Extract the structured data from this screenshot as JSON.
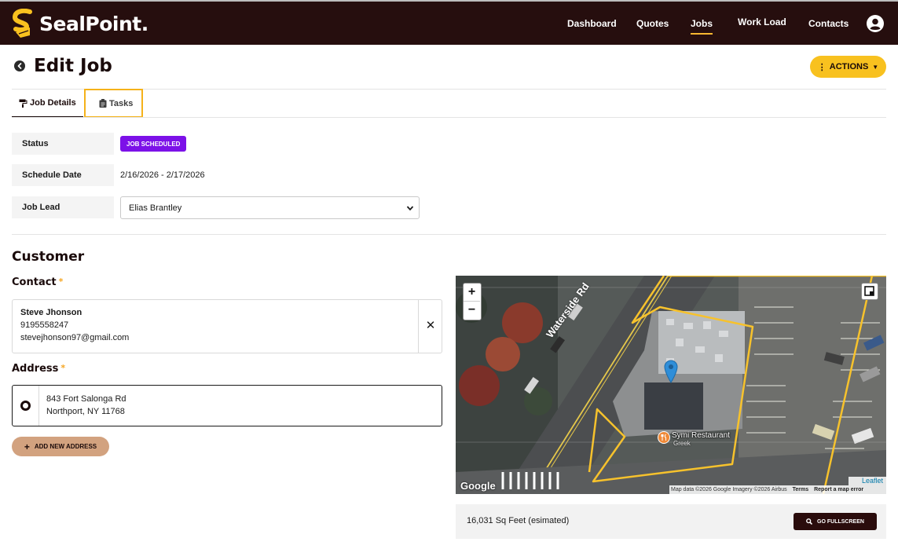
{
  "app": {
    "brand": "SealPoint."
  },
  "nav": {
    "items": [
      {
        "label": "Dashboard"
      },
      {
        "label": "Quotes"
      },
      {
        "label": "Jobs",
        "active": true
      },
      {
        "label": "Work Load"
      },
      {
        "label": "Contacts"
      }
    ],
    "user_icon": "user-circle-icon"
  },
  "header": {
    "title": "Edit Job",
    "back_icon": "arrow-left-circle-icon",
    "actions_label": "ACTIONS"
  },
  "tabs": [
    {
      "label": "Job Details",
      "icon": "paint-roller-icon",
      "active": true
    },
    {
      "label": "Tasks",
      "icon": "clipboard-icon",
      "highlighted": true
    }
  ],
  "details": {
    "status": {
      "label": "Status",
      "value": "JOB SCHEDULED"
    },
    "schedule": {
      "label": "Schedule Date",
      "value": "2/16/2026 - 2/17/2026"
    },
    "job_lead": {
      "label": "Job Lead",
      "value": "Elias Brantley"
    }
  },
  "customer": {
    "title": "Customer",
    "contact_label": "Contact",
    "required_mark": "*",
    "contact": {
      "name": "Steve Jhonson",
      "phone": "9195558247",
      "email": "stevejhonson97@gmail.com"
    },
    "address_label": "Address",
    "address": {
      "line1": "843 Fort Salonga Rd",
      "line2": "Northport, NY 11768"
    },
    "add_address_label": "ADD NEW ADDRESS"
  },
  "map": {
    "street": "Waterside Rd",
    "poi_name": "Symi Restaurant",
    "poi_category": "Greek",
    "zoom_in": "+",
    "zoom_out": "−",
    "google": "Google",
    "leaflet": "Leaflet",
    "attribution": "Map data ©2026 Google Imagery ©2026 Airbus",
    "terms": "Terms",
    "report": "Report a map error",
    "area_text": "16,031 Sq Feet (esimated)",
    "fullscreen_label": "GO FULLSCREEN"
  },
  "colors": {
    "topbar": "#260e0e",
    "accent": "#f8c11f",
    "status_badge": "#7c11e8",
    "add_button": "#d2a27f"
  }
}
